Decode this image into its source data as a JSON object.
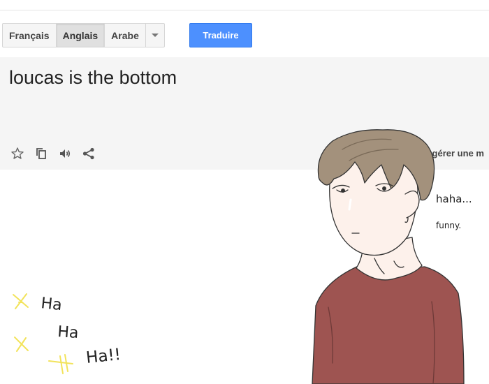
{
  "languages": {
    "items": [
      {
        "label": "Français",
        "selected": false
      },
      {
        "label": "Anglais",
        "selected": true
      },
      {
        "label": "Arabe",
        "selected": false
      }
    ]
  },
  "translate_button": {
    "label": "Traduire"
  },
  "source": {
    "text": "loucas is the bottom",
    "icons": [
      "star-icon",
      "copy-icon",
      "speaker-icon",
      "share-icon"
    ],
    "suggest_partial": "iggérer une m"
  },
  "doodle": {
    "speech_line1": "haha...",
    "speech_line2": "funny.",
    "laugh1": "Ha",
    "laugh2": "Ha",
    "laugh3": "Ha!!",
    "colors": {
      "shirt": "#9e5451",
      "hair": "#a3917c",
      "skin": "#fdf1eb",
      "sparkle": "#f2e35b"
    }
  },
  "colors": {
    "accent": "#4d90fe",
    "panel": "#f5f5f5"
  }
}
